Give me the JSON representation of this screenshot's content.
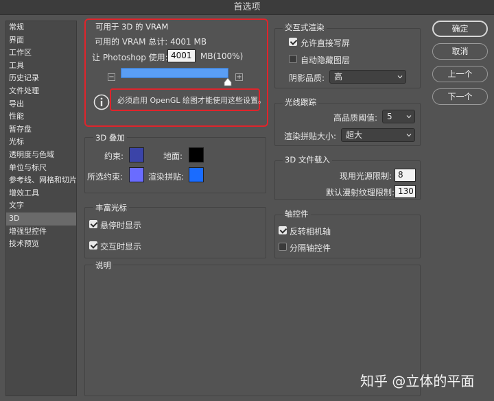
{
  "window": {
    "title": "首选项"
  },
  "sidebar": {
    "items": [
      "常规",
      "界面",
      "工作区",
      "工具",
      "历史记录",
      "文件处理",
      "导出",
      "性能",
      "暂存盘",
      "光标",
      "透明度与色域",
      "单位与标尺",
      "参考线、网格和切片",
      "增效工具",
      "文字",
      "3D",
      "增强型控件",
      "技术预览"
    ],
    "selected_label": "3D"
  },
  "vram": {
    "title": "可用于 3D 的 VRAM",
    "total_text": "可用的 VRAM 总计:  4001 MB",
    "usage_label": "让 Photoshop 使用:",
    "usage_value": "4001",
    "usage_suffix": "MB(100%)",
    "slider_percent": 100,
    "minus": "−",
    "plus": "+",
    "notice": "必须启用 OpenGL 绘图才能使用这些设置。"
  },
  "overlay3d": {
    "title": "3D 叠加",
    "constraint_label": "约束:",
    "ground_label": "地面:",
    "selected_constraint_label": "所选约束:",
    "render_tiles_label": "渲染拼贴:",
    "colors": {
      "constraint": "#3b44a8",
      "ground": "#000000",
      "selected_constraint": "#6a6cff",
      "render_tiles": "#1a6cff"
    }
  },
  "rich_cursor": {
    "title": "丰富光标",
    "show_on_hover": {
      "label": "悬停时显示",
      "checked": true
    },
    "show_on_interact": {
      "label": "交互时显示",
      "checked": true
    }
  },
  "interactive_render": {
    "title": "交互式渲染",
    "allow_direct_write": {
      "label": "允许直接写屏",
      "checked": true
    },
    "auto_hide_layers": {
      "label": "自动隐藏图层",
      "checked": false
    },
    "shadow_quality_label": "阴影品质:",
    "shadow_quality_value": "高"
  },
  "ray_tracing": {
    "title": "光线跟踪",
    "threshold_label": "高品质阈值:",
    "threshold_value": "5",
    "tile_size_label": "渲染拼贴大小:",
    "tile_size_value": "超大"
  },
  "file_loading": {
    "title": "3D 文件载入",
    "light_limit_label": "现用光源限制:",
    "light_limit_value": "8",
    "texture_limit_label": "默认漫射纹理限制:",
    "texture_limit_value": "130"
  },
  "axis_widget": {
    "title": "轴控件",
    "invert_camera": {
      "label": "反转相机轴",
      "checked": true
    },
    "separate_widget": {
      "label": "分隔轴控件",
      "checked": false
    }
  },
  "description": {
    "title": "说明"
  },
  "buttons": {
    "ok": "确定",
    "cancel": "取消",
    "prev": "上一个",
    "next": "下一个"
  },
  "watermark": "知乎 @立体的平面"
}
